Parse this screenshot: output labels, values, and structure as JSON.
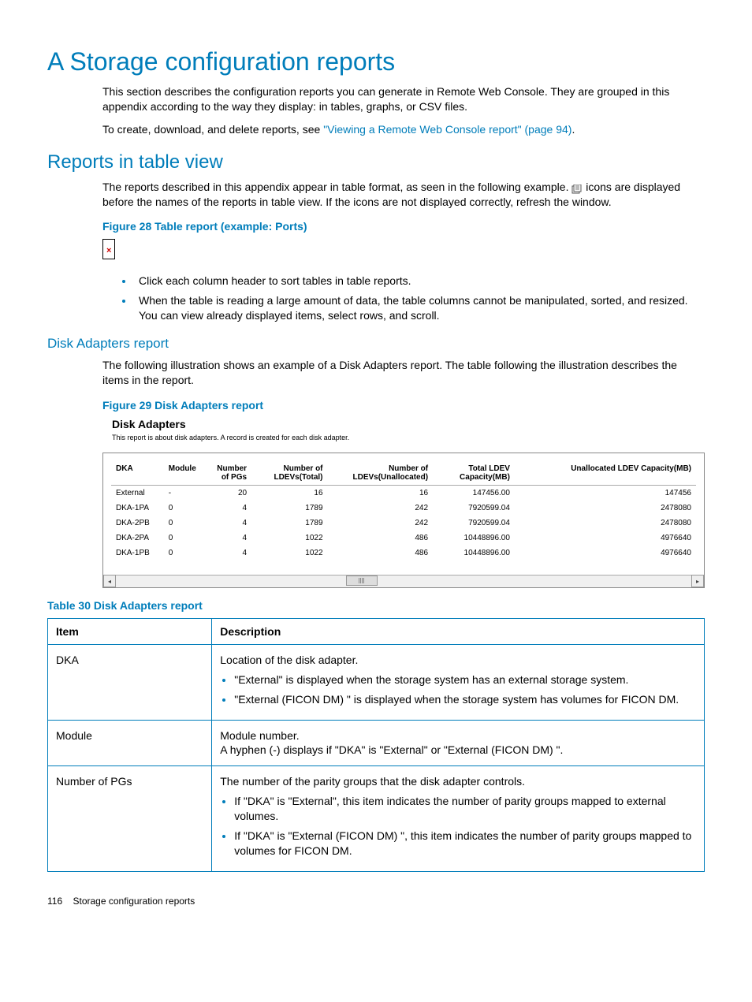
{
  "title": "A Storage configuration reports",
  "intro_p1": "This section describes the configuration reports you can generate in Remote Web Console. They are grouped in this appendix according to the way they display: in tables, graphs, or CSV files.",
  "intro_p2_pre": "To create, download, and delete reports, see ",
  "intro_p2_link": "\"Viewing a Remote Web Console report\" (page 94)",
  "intro_p2_post": ".",
  "section_table_view": {
    "heading": "Reports in table view",
    "p_pre": "The reports described in this appendix appear in table format, as seen in the following example. ",
    "p_post": " icons are displayed before the names of the reports in table view. If the icons are not displayed correctly, refresh the window.",
    "figure_caption": "Figure 28 Table report (example: Ports)",
    "bullet1": "Click each column header to sort tables in table reports.",
    "bullet2": "When the table is reading a large amount of data, the table columns cannot be manipulated, sorted, and resized. You can view already displayed items, select rows, and scroll."
  },
  "section_disk_adapters": {
    "heading": "Disk Adapters report",
    "para": "The following illustration shows an example of a Disk Adapters report. The table following the illustration describes the items in the report.",
    "figure_caption": "Figure 29 Disk Adapters report",
    "report_title": "Disk Adapters",
    "report_sub": "This report is about disk adapters. A record is created for each disk adapter.",
    "columns": {
      "c1": "DKA",
      "c2": "Module",
      "c3": "Number of PGs",
      "c4": "Number of LDEVs(Total)",
      "c5": "Number of LDEVs(Unallocated)",
      "c6": "Total LDEV Capacity(MB)",
      "c7": "Unallocated LDEV Capacity(MB)"
    },
    "rows": [
      {
        "c1": "External",
        "c2": "-",
        "c3": "20",
        "c4": "16",
        "c5": "16",
        "c6": "147456.00",
        "c7": "147456"
      },
      {
        "c1": "DKA-1PA",
        "c2": "0",
        "c3": "4",
        "c4": "1789",
        "c5": "242",
        "c6": "7920599.04",
        "c7": "2478080"
      },
      {
        "c1": "DKA-2PB",
        "c2": "0",
        "c3": "4",
        "c4": "1789",
        "c5": "242",
        "c6": "7920599.04",
        "c7": "2478080"
      },
      {
        "c1": "DKA-2PA",
        "c2": "0",
        "c3": "4",
        "c4": "1022",
        "c5": "486",
        "c6": "10448896.00",
        "c7": "4976640"
      },
      {
        "c1": "DKA-1PB",
        "c2": "0",
        "c3": "4",
        "c4": "1022",
        "c5": "486",
        "c6": "10448896.00",
        "c7": "4976640"
      }
    ]
  },
  "table30": {
    "caption": "Table 30 Disk Adapters report",
    "head_item": "Item",
    "head_desc": "Description",
    "rows": [
      {
        "item": "DKA",
        "line": "Location of the disk adapter.",
        "bullets": [
          "\"External\" is displayed when the storage system has an external storage system.",
          "\"External (FICON DM) \" is displayed when the storage system has volumes for FICON DM."
        ]
      },
      {
        "item": "Module",
        "line": "Module number.",
        "line2": "A hyphen (-) displays if \"DKA\" is \"External\" or \"External (FICON DM) \".",
        "bullets": []
      },
      {
        "item": "Number of PGs",
        "line": "The number of the parity groups that the disk adapter controls.",
        "bullets": [
          "If \"DKA\" is \"External\", this item indicates the number of parity groups mapped to external volumes.",
          "If \"DKA\" is \"External (FICON DM) \", this item indicates the number of parity groups mapped to volumes for FICON DM."
        ]
      }
    ]
  },
  "footer_page": "116",
  "footer_text": "Storage configuration reports"
}
